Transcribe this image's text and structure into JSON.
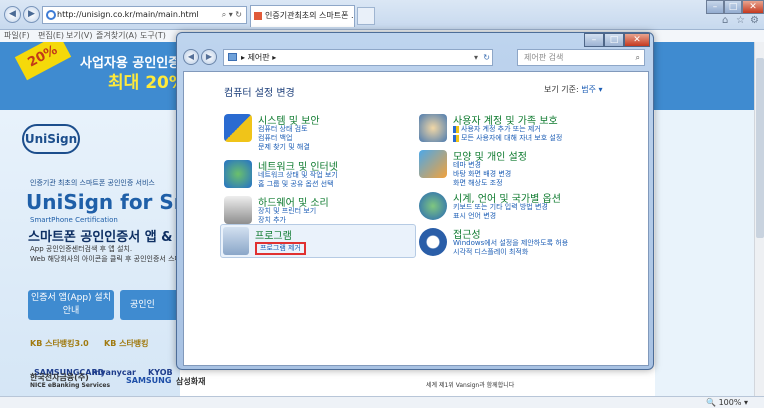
{
  "browser": {
    "url": "http://unisign.co.kr/main/main.html",
    "tab_title": "인증기관최초의 스마트폰 ...",
    "menu": [
      "파일(F)",
      "편집(E)",
      "보기(V)",
      "즐겨찾기(A)",
      "도구(T)"
    ],
    "zoom": "100%",
    "icons": {
      "back": "back-arrow-icon",
      "forward": "forward-arrow-icon",
      "home": "home-icon",
      "favorites": "star-icon",
      "tools": "gear-icon"
    }
  },
  "webpage": {
    "banner_badge": "20%",
    "banner_line1": "사업자용 공인인증서",
    "banner_line2": "최대 20%",
    "logo": "UniSign",
    "promo_small": "인증기관 최초의 스마트폰 공인인증 서비스",
    "promo_big": "UniSign for Sm",
    "promo_cert": "SmartPhone Certification",
    "promo_app": "스마트폰 공인인증서 앱 & 웹",
    "promo_line1": "App 공인인증센터검색 후 앱 설치.",
    "promo_line2": "Web 해당회사의 아이콘을 클릭 후 공인인증서 스마",
    "cert_app_button": "인증서 앱(App) 설치안내",
    "cert_web_button": "공인인",
    "banks": [
      "KB 스타뱅킹3.0",
      "KB 스타뱅킹",
      "SAMSUNGCARD",
      "myanycar",
      "KYOB",
      "한국전자금융(주)",
      "NICE eBanking Services",
      "SAMSUNG",
      "삼성화재"
    ],
    "bottom_text": "세계 제1위 Vansign과 함께합니다"
  },
  "control_panel": {
    "breadcrumb": "제어판",
    "search_placeholder": "제어판 검색",
    "heading": "컴퓨터 설정 변경",
    "view_by_label": "보기 기준:",
    "view_by_value": "범주",
    "categories": [
      {
        "title": "시스템 및 보안",
        "links": [
          "컴퓨터 상태 검토",
          "컴퓨터 백업",
          "문제 찾기 및 해결"
        ],
        "icon": "shield-icon"
      },
      {
        "title": "네트워크 및 인터넷",
        "links": [
          "네트워크 상태 및 작업 보기",
          "홈 그룹 및 공유 옵션 선택"
        ],
        "icon": "network-globe-icon"
      },
      {
        "title": "하드웨어 및 소리",
        "links": [
          "장치 및 프린터 보기",
          "장치 추가"
        ],
        "icon": "printer-icon"
      },
      {
        "title": "프로그램",
        "links": [
          "프로그램 제거"
        ],
        "icon": "programs-icon"
      },
      {
        "title": "사용자 계정 및 가족 보호",
        "links": [
          "사용자 계정 추가 또는 제거",
          "모든 사용자에 대해 자녀 보호 설정"
        ],
        "icon": "users-icon"
      },
      {
        "title": "모양 및 개인 설정",
        "links": [
          "테마 변경",
          "바탕 화면 배경 변경",
          "화면 해상도 조정"
        ],
        "icon": "appearance-icon"
      },
      {
        "title": "시계, 언어 및 국가별 옵션",
        "links": [
          "키보드 또는 기타 입력 방법 변경",
          "표시 언어 변경"
        ],
        "icon": "clock-globe-icon"
      },
      {
        "title": "접근성",
        "links": [
          "Windows에서 설정을 제안하도록 허용",
          "시각적 디스플레이 최적화"
        ],
        "icon": "accessibility-icon"
      }
    ]
  }
}
